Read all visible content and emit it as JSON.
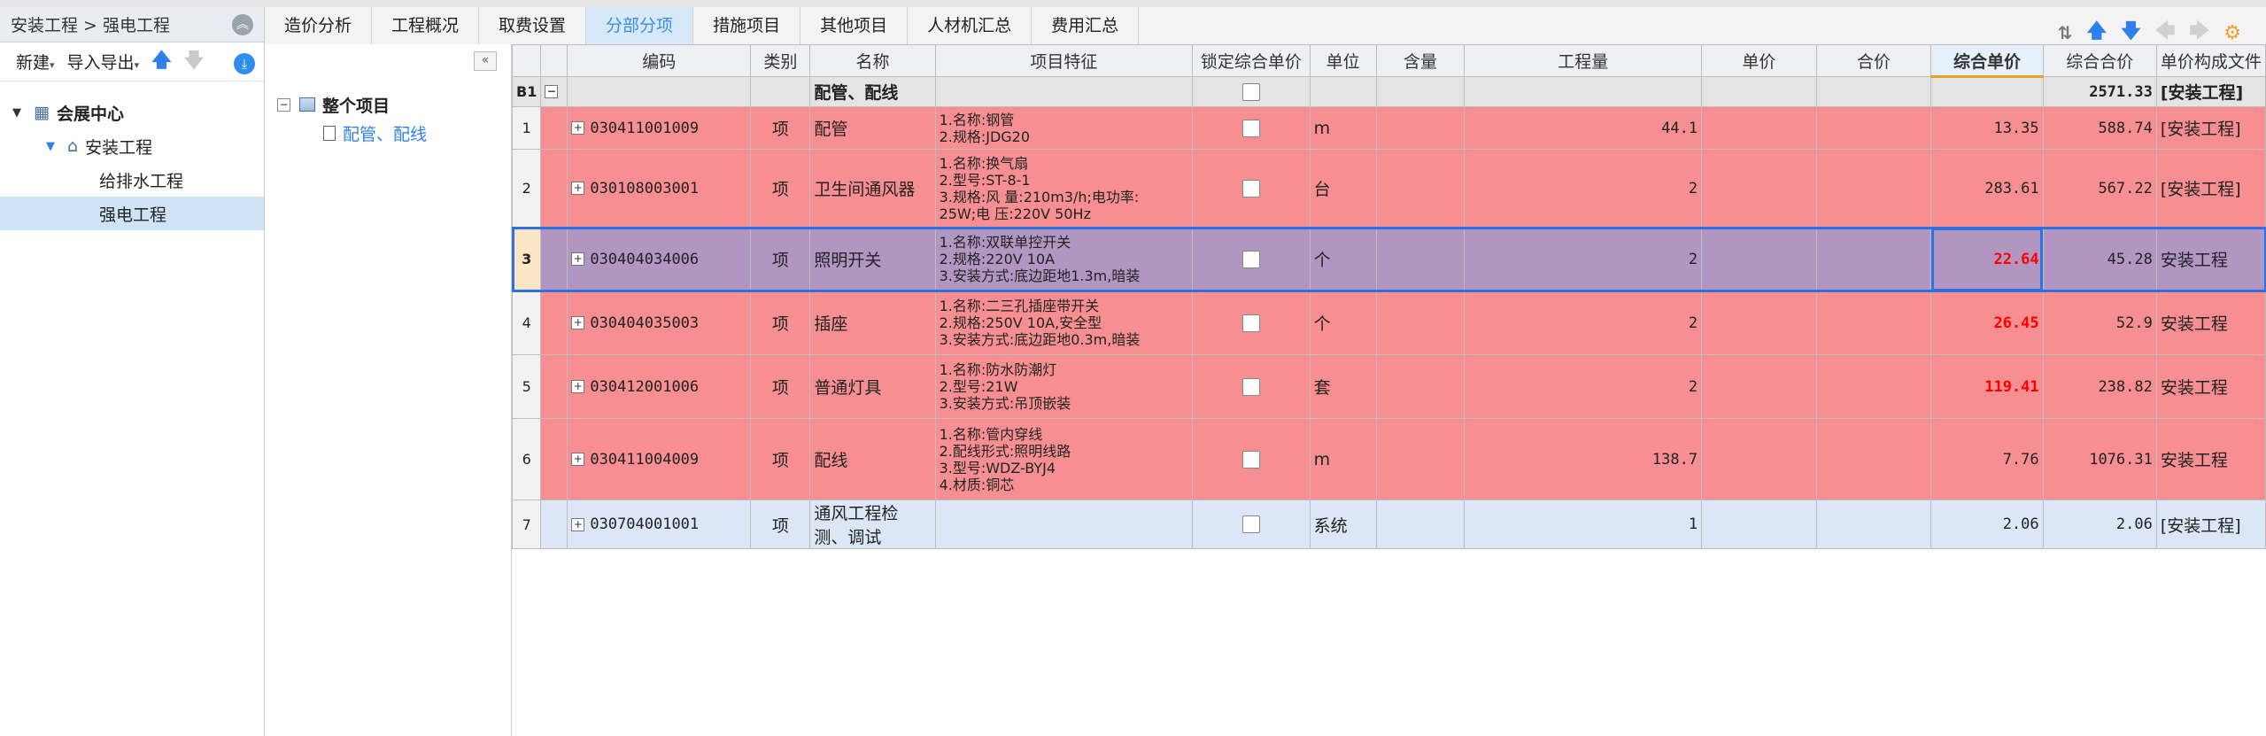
{
  "breadcrumb": "安装工程 > 强电工程",
  "left_toolbar": {
    "new_label": "新建",
    "import_export_label": "导入导出"
  },
  "tree": [
    {
      "label": "会展中心",
      "level": 0,
      "expanded": true
    },
    {
      "label": "安装工程",
      "level": 1,
      "expanded": true
    },
    {
      "label": "给排水工程",
      "level": 2
    },
    {
      "label": "强电工程",
      "level": 2,
      "selected": true
    }
  ],
  "middle_tree": {
    "root_label": "整个项目",
    "child_label": "配管、配线"
  },
  "tabs": [
    "造价分析",
    "工程概况",
    "取费设置",
    "分部分项",
    "措施项目",
    "其他项目",
    "人材机汇总",
    "费用汇总"
  ],
  "active_tab": "分部分项",
  "columns": [
    "编码",
    "类别",
    "名称",
    "项目特征",
    "锁定综合单价",
    "单位",
    "含量",
    "工程量",
    "单价",
    "合价",
    "综合单价",
    "综合合价",
    "单价构成文件"
  ],
  "group_row": {
    "rn": "B1",
    "name": "配管、配线",
    "total": "2571.33",
    "file": "[安装工程]"
  },
  "rows": [
    {
      "rn": "1",
      "code": "030411001009",
      "type": "项",
      "name": "配管",
      "feature": "1.名称:钢管\n2.规格:JDG20",
      "unit": "m",
      "qty": "44.1",
      "unit_price": "",
      "total_price": "",
      "comp_unit": "13.35",
      "comp_total": "588.74",
      "file": "[安装工程]",
      "style": "red"
    },
    {
      "rn": "2",
      "code": "030108003001",
      "type": "项",
      "name": "卫生间通风器",
      "feature": "1.名称:换气扇\n2.型号:ST-8-1\n3.规格:风 量:210m3/h;电功率:\n25W;电 压:220V 50Hz",
      "unit": "台",
      "qty": "2",
      "unit_price": "",
      "total_price": "",
      "comp_unit": "283.61",
      "comp_total": "567.22",
      "file": "[安装工程]",
      "style": "red"
    },
    {
      "rn": "3",
      "code": "030404034006",
      "type": "项",
      "name": "照明开关",
      "feature": "1.名称:双联单控开关\n2.规格:220V 10A\n3.安装方式:底边距地1.3m,暗装",
      "unit": "个",
      "qty": "2",
      "unit_price": "",
      "total_price": "",
      "comp_unit": "22.64",
      "comp_total": "45.28",
      "file": "安装工程",
      "style": "sel",
      "comp_red": true
    },
    {
      "rn": "4",
      "code": "030404035003",
      "type": "项",
      "name": "插座",
      "feature": "1.名称:二三孔插座带开关\n2.规格:250V 10A,安全型\n3.安装方式:底边距地0.3m,暗装",
      "unit": "个",
      "qty": "2",
      "unit_price": "",
      "total_price": "",
      "comp_unit": "26.45",
      "comp_total": "52.9",
      "file": "安装工程",
      "style": "red",
      "comp_red": true
    },
    {
      "rn": "5",
      "code": "030412001006",
      "type": "项",
      "name": "普通灯具",
      "feature": "1.名称:防水防潮灯\n2.型号:21W\n3.安装方式:吊顶嵌装",
      "unit": "套",
      "qty": "2",
      "unit_price": "",
      "total_price": "",
      "comp_unit": "119.41",
      "comp_total": "238.82",
      "file": "安装工程",
      "style": "red",
      "comp_red": true
    },
    {
      "rn": "6",
      "code": "030411004009",
      "type": "项",
      "name": "配线",
      "feature": "1.名称:管内穿线\n2.配线形式:照明线路\n3.型号:WDZ-BYJ4\n4.材质:铜芯",
      "unit": "m",
      "qty": "138.7",
      "unit_price": "",
      "total_price": "",
      "comp_unit": "7.76",
      "comp_total": "1076.31",
      "file": "安装工程",
      "style": "red"
    },
    {
      "rn": "7",
      "code": "030704001001",
      "type": "项",
      "name": "通风工程检测、调试",
      "feature": "",
      "unit": "系统",
      "qty": "1",
      "unit_price": "",
      "total_price": "",
      "comp_unit": "2.06",
      "comp_total": "2.06",
      "file": "[安装工程]",
      "style": "blue"
    }
  ],
  "colors": {
    "row_red": "#f78f92",
    "row_selected": "#b196c2",
    "row_blue": "#dbe6f7",
    "accent": "#2f80ed",
    "highlight_text": "#ff0000"
  },
  "icons": [
    "collapse-up-icon",
    "arrow-up-icon",
    "arrow-down-icon",
    "download-icon",
    "collapse-left-icon",
    "building-icon",
    "home-icon",
    "document-icon"
  ]
}
